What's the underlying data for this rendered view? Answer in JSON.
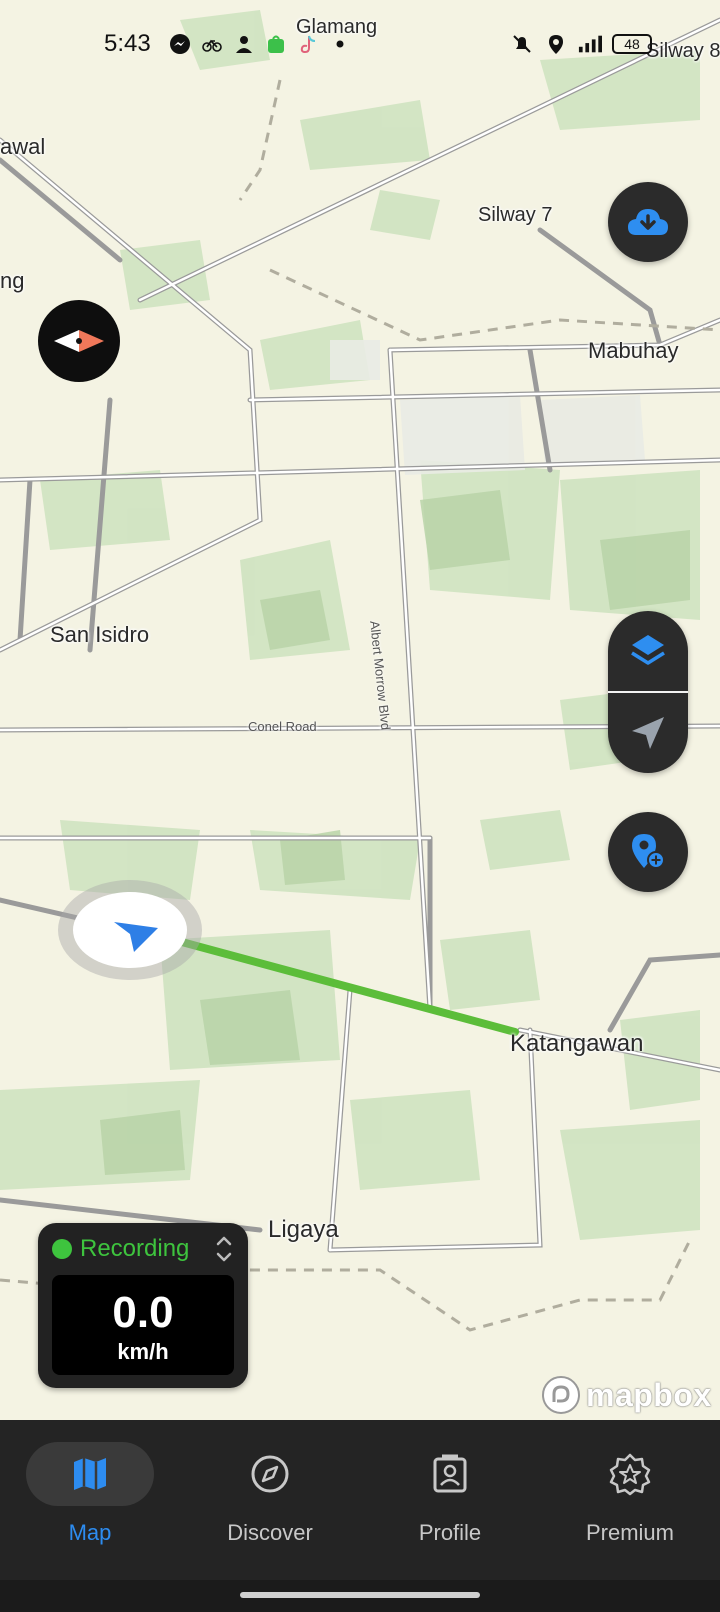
{
  "status_bar": {
    "time": "5:43",
    "battery": "48",
    "left_icons": [
      "messenger-icon",
      "bicycle-icon",
      "person-icon",
      "shopping-bag-icon",
      "tiktok-icon",
      "dot-icon"
    ],
    "right_icons": [
      "bell-off-icon",
      "location-pin-icon",
      "signal-bars-icon",
      "battery-icon"
    ]
  },
  "map": {
    "places": {
      "glamang": "Glamang",
      "silway8": "Silway 8",
      "awal": "awal",
      "silway7": "Silway 7",
      "ng": "ng",
      "mabuhay": "Mabuhay",
      "san_isidro": "San Isidro",
      "katangawan": "Katangawan",
      "ligaya": "Ligaya"
    },
    "roads": {
      "conel": "Conel Road",
      "albert": "Albert Morrow Blvd"
    },
    "route_color": "#5cbd3a",
    "attribution": "mapbox"
  },
  "controls": {
    "compass": "compass-icon",
    "download": "cloud-download-icon",
    "layers": "layers-icon",
    "locate": "navigation-arrow-icon",
    "add_poi": "add-location-icon"
  },
  "recording": {
    "label": "Recording",
    "speed": "0.0",
    "unit": "km/h",
    "status_color": "#3ec43e"
  },
  "bottom_nav": {
    "items": [
      {
        "label": "Map",
        "icon": "map-icon",
        "active": true
      },
      {
        "label": "Discover",
        "icon": "compass-outline-icon",
        "active": false
      },
      {
        "label": "Profile",
        "icon": "profile-badge-icon",
        "active": false
      },
      {
        "label": "Premium",
        "icon": "star-badge-icon",
        "active": false
      }
    ],
    "accent": "#2d8cf0"
  }
}
